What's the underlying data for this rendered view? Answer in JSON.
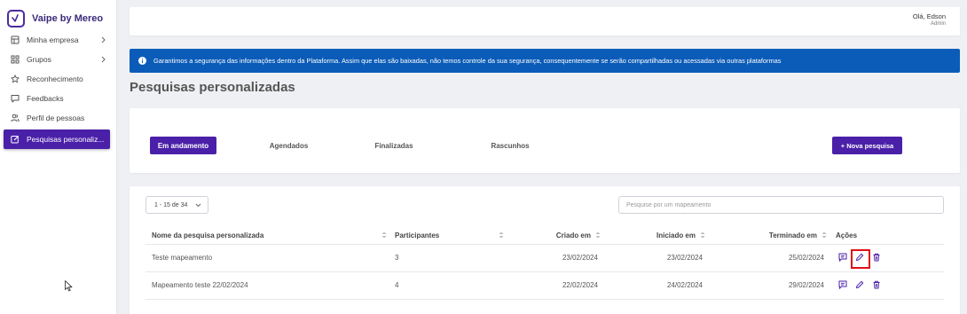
{
  "brand": {
    "name": "Vaipe by Mereo",
    "logo_icon": "vaipe-logo-icon",
    "accent_color": "#4a20a8"
  },
  "sidebar": {
    "items": [
      {
        "label": "Minha empresa",
        "icon": "building-icon",
        "has_chevron": true
      },
      {
        "label": "Grupos",
        "icon": "grid-icon",
        "has_chevron": true
      },
      {
        "label": "Reconhecimento",
        "icon": "star-icon",
        "has_chevron": false
      },
      {
        "label": "Feedbacks",
        "icon": "chat-icon",
        "has_chevron": false
      },
      {
        "label": "Perfil de pessoas",
        "icon": "people-icon",
        "has_chevron": false
      },
      {
        "label": "Pesquisas personaliz...",
        "icon": "edit-icon",
        "has_chevron": false,
        "active": true
      }
    ]
  },
  "header": {
    "greeting": "Olá, Edson",
    "role": "Admin"
  },
  "alert": {
    "text": "Garantimos a segurança das informações dentro da Plataforma. Assim que elas são baixadas, não temos controle da sua segurança, consequentemente se serão compartilhadas ou acessadas via outras plataformas",
    "color": "#0b5cb8"
  },
  "page": {
    "title": "Pesquisas personalizadas"
  },
  "tabs": [
    {
      "label": "Em andamento",
      "active": true
    },
    {
      "label": "Agendados"
    },
    {
      "label": "Finalizadas"
    },
    {
      "label": "Rascunhos"
    }
  ],
  "new_button": {
    "label": "+ Nova pesquisa"
  },
  "table": {
    "pager_label": "1 - 15 de 34",
    "search_placeholder": "Pesquise por um mapeamento",
    "columns": [
      "Nome da pesquisa personalizada",
      "Participantes",
      "Criado em",
      "Iniciado em",
      "Terminado em",
      "Ações"
    ],
    "rows": [
      {
        "name": "Teste mapeamento",
        "participants": "3",
        "created": "23/02/2024",
        "started": "23/02/2024",
        "ended": "25/02/2024"
      },
      {
        "name": "Mapeamento teste 22/02/2024",
        "participants": "4",
        "created": "22/02/2024",
        "started": "24/02/2024",
        "ended": "29/02/2024"
      }
    ],
    "action_icons": [
      "comment-icon",
      "pencil-icon",
      "trash-icon"
    ],
    "highlight_color": "#e0101a"
  }
}
